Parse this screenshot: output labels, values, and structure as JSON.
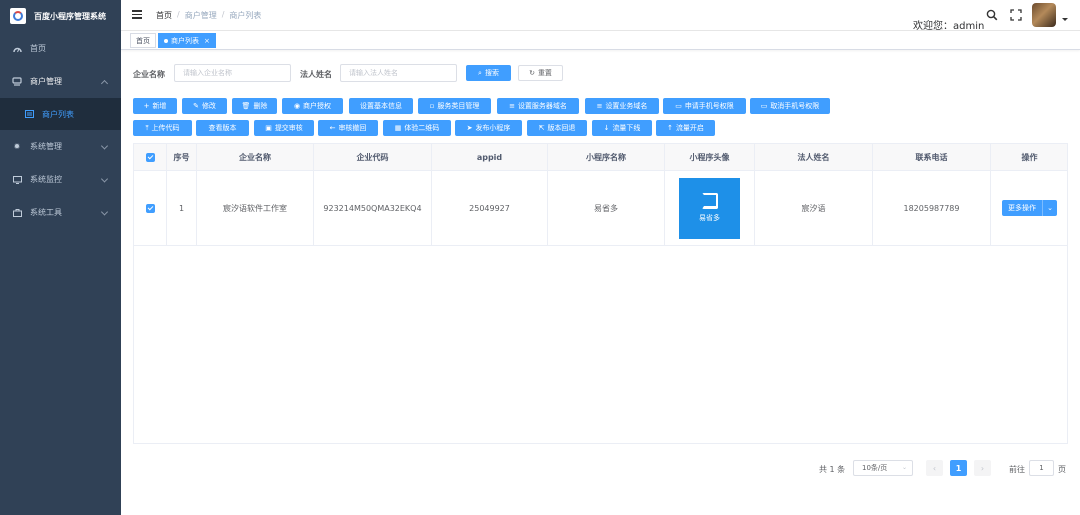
{
  "app": {
    "title": "百度小程序管理系统"
  },
  "sidebar": {
    "items": [
      {
        "label": "首页",
        "icon": "dashboard-icon"
      },
      {
        "label": "商户管理",
        "icon": "shop-icon"
      },
      {
        "label": "商户列表",
        "icon": "list-icon"
      },
      {
        "label": "系统管理",
        "icon": "gear-icon"
      },
      {
        "label": "系统监控",
        "icon": "monitor-icon"
      },
      {
        "label": "系统工具",
        "icon": "toolbox-icon"
      }
    ]
  },
  "header": {
    "breadcrumb": [
      "首页",
      "商户管理",
      "商户列表"
    ],
    "welcome": "欢迎您：admin"
  },
  "tags": {
    "home": "首页",
    "current": "商户列表"
  },
  "search": {
    "company_label": "企业名称",
    "company_placeholder": "请输入企业名称",
    "person_label": "法人姓名",
    "person_placeholder": "请输入法人姓名",
    "search_btn": "搜索",
    "reset_btn": "重置"
  },
  "toolbar": {
    "row1": [
      "新增",
      "修改",
      "删除",
      "商户授权",
      "设置基本信息",
      "服务类目管理",
      "设置服务器域名",
      "设置业务域名",
      "申请手机号权限",
      "取消手机号权限"
    ],
    "row2": [
      "上传代码",
      "查看版本",
      "提交审核",
      "审核撤回",
      "体验二维码",
      "发布小程序",
      "版本回退",
      "流量下线",
      "流量开启"
    ]
  },
  "table": {
    "headers": [
      "序号",
      "企业名称",
      "企业代码",
      "appid",
      "小程序名称",
      "小程序头像",
      "法人姓名",
      "联系电话",
      "操作"
    ],
    "rows": [
      {
        "index": "1",
        "company": "宸汐语软件工作室",
        "code": "923214M50QMA32EKQ4",
        "appid": "25049927",
        "mini_name": "易省多",
        "avatar_text": "易省多",
        "person": "宸汐语",
        "phone": "18205987789",
        "action": "更多操作"
      }
    ]
  },
  "pagination": {
    "total": "共 1 条",
    "page_size": "10条/页",
    "current": "1",
    "goto_label": "前往",
    "goto_value": "1",
    "page_unit": "页"
  },
  "colors": {
    "sidebar_bg": "#304156",
    "primary": "#409eff"
  }
}
